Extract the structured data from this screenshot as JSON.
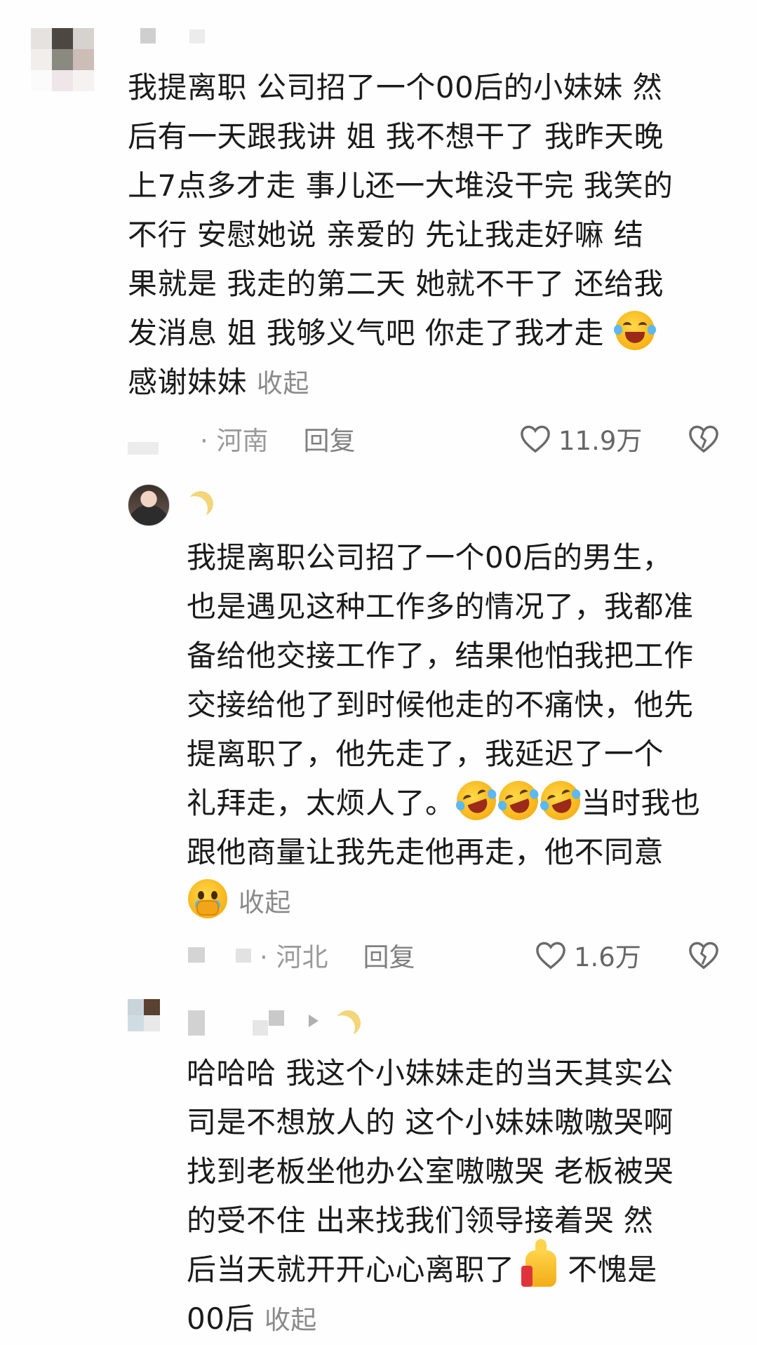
{
  "comments": [
    {
      "lines": [
        "我提离职  公司招了一个00后的小妹妹   然",
        "后有一天跟我讲  姐  我不想干了  我昨天晚",
        "上7点多才走  事儿还一大堆没干完   我笑的",
        "不行  安慰她说  亲爱的  先让我走好嘛   结",
        "果就是  我走的第二天  她就不干了  还给我",
        "发消息  姐  我够义气吧    你走了我才走",
        "感谢妹妹"
      ],
      "emoji_line6": "loudly-crying-face",
      "collapse": "收起",
      "location": "· 河南",
      "reply": "回复",
      "likes": "11.9万"
    },
    {
      "lines": [
        "我提离职公司招了一个00后的男生，",
        "也是遇见这种工作多的情况了，我都准",
        "备给他交接工作了，结果他怕我把工作",
        "交接给他了到时候他走的不痛快，他先",
        "提离职了，他先走了，我延迟了一个",
        "礼拜走，太烦人了。",
        "当时我也",
        "跟他商量让我先走他再走，他不同意"
      ],
      "emoji_line6": "rolling-on-floor-laughing",
      "emoji_line9": "face-holding-back-tears",
      "collapse": "收起",
      "location": "· 河北",
      "reply": "回复",
      "likes": "1.6万"
    },
    {
      "lines": [
        "哈哈哈  我这个小妹妹走的当天其实公",
        "司是不想放人的   这个小妹妹嗷嗷哭啊",
        "找到老板坐他办公室嗷嗷哭   老板被哭",
        "的受不住  出来找我们领导接着哭   然",
        "后当天就开开心心离职了",
        "不愧是",
        "00后"
      ],
      "emoji_line5": "thumbs-up",
      "collapse": "收起"
    }
  ],
  "colors": {
    "text": "#1b1b1b",
    "meta": "#9a9a9a",
    "collapse": "#8a8a8a",
    "background": "#fefefe"
  }
}
